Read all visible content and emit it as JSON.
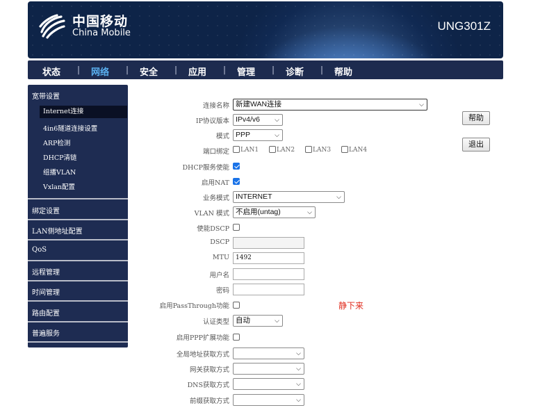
{
  "header": {
    "brand_cn": "中国移动",
    "brand_en": "China Mobile",
    "model": "UNG301Z"
  },
  "nav": {
    "tabs": [
      {
        "label": "状态"
      },
      {
        "label": "网络",
        "active": true
      },
      {
        "label": "安全"
      },
      {
        "label": "应用"
      },
      {
        "label": "管理"
      },
      {
        "label": "诊断"
      },
      {
        "label": "帮助"
      }
    ],
    "separator": "|"
  },
  "sidebar": {
    "sections": [
      {
        "label": "宽带设置",
        "items": [
          "Internet连接",
          "4in6隧道连接设置",
          "ARP检测",
          "DHCP清链",
          "组播VLAN",
          "Vxlan配置"
        ],
        "active_item": "Internet连接"
      },
      {
        "label": "绑定设置"
      },
      {
        "label": "LAN侧地址配置"
      },
      {
        "label": "QoS"
      },
      {
        "label": "远程管理"
      },
      {
        "label": "时间管理"
      },
      {
        "label": "路由配置"
      },
      {
        "label": "普遍服务"
      }
    ]
  },
  "form": {
    "connection_name": {
      "label": "连接名称",
      "value": "新建WAN连接"
    },
    "ip_version": {
      "label": "IP协议版本",
      "value": "IPv4/v6"
    },
    "mode": {
      "label": "模式",
      "value": "PPP"
    },
    "port_binding": {
      "label": "端口绑定",
      "ports": [
        "LAN1",
        "LAN2",
        "LAN3",
        "LAN4"
      ]
    },
    "dhcp_enable": {
      "label": "DHCP服务使能",
      "checked": true
    },
    "nat_enable": {
      "label": "启用NAT",
      "checked": true
    },
    "service_mode": {
      "label": "业务模式",
      "value": "INTERNET"
    },
    "vlan_mode": {
      "label": "VLAN 模式",
      "value": "不启用(untag)"
    },
    "dscp_enable": {
      "label": "使能DSCP",
      "checked": false
    },
    "dscp": {
      "label": "DSCP",
      "value": ""
    },
    "mtu": {
      "label": "MTU",
      "value": "1492"
    },
    "username": {
      "label": "用户名",
      "value": ""
    },
    "password": {
      "label": "密码",
      "value": ""
    },
    "passthrough": {
      "label": "启用PassThrough功能",
      "checked": false
    },
    "auth_type": {
      "label": "认证类型",
      "value": "自动"
    },
    "ppp_ext": {
      "label": "启用PPP扩展功能",
      "checked": false
    },
    "global_addr": {
      "label": "全局地址获取方式",
      "value": ""
    },
    "gateway": {
      "label": "网关获取方式",
      "value": ""
    },
    "dns": {
      "label": "DNS获取方式",
      "value": ""
    },
    "prefix": {
      "label": "前缀获取方式",
      "value": ""
    }
  },
  "buttons": {
    "help": "帮助",
    "logout": "退出"
  },
  "annotation": "静下来",
  "colors": {
    "nav_bg": "#1d2b4f",
    "active_tab": "#5ab0f0",
    "checkbox": "#1a73e8",
    "annotation": "#e02b1c"
  }
}
